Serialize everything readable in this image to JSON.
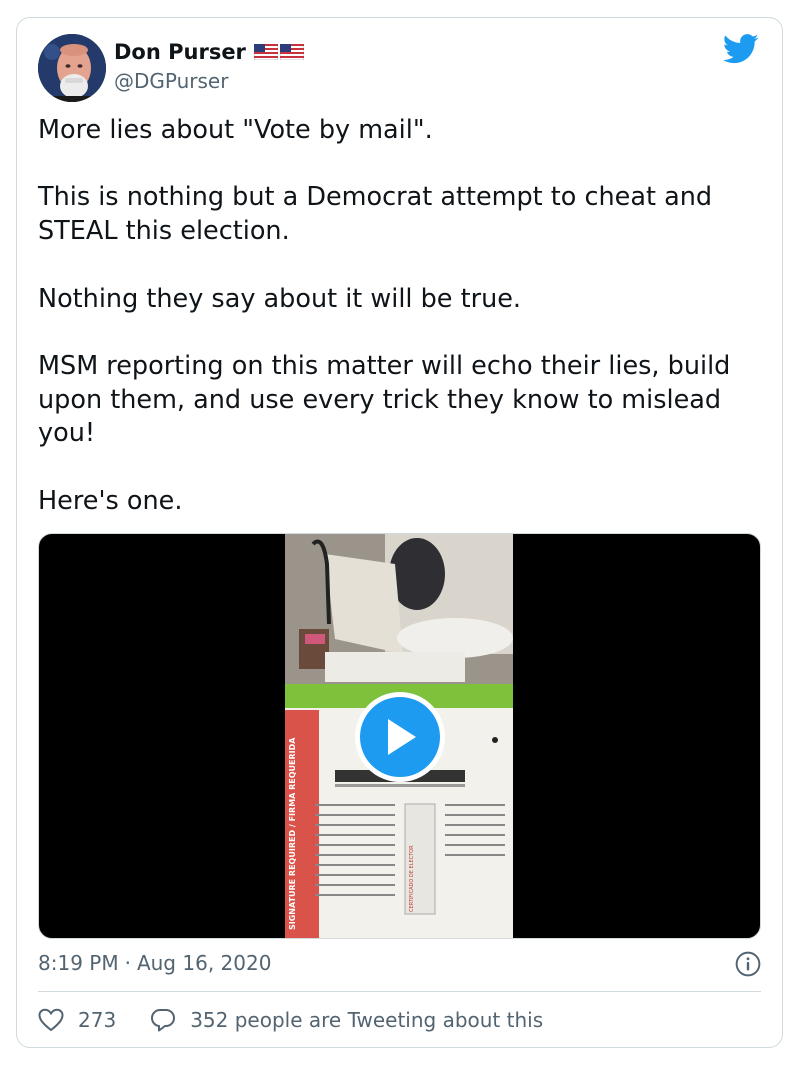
{
  "author": {
    "name": "Don Purser",
    "handle": "@DGPurser",
    "flags": [
      "us-flag",
      "us-flag"
    ]
  },
  "tweet": {
    "text": "More lies about \"Vote by mail\".\n\nThis is nothing but a Democrat attempt to cheat and STEAL this election.\n\nNothing they say about it will be true.\n\nMSM reporting on this matter will echo their lies, build upon them, and use every trick they know to mislead you!\n\nHere's one.",
    "time": "8:19 PM",
    "separator": "·",
    "date": "Aug 16, 2020"
  },
  "media": {
    "type": "video",
    "overlay_icon": "play-icon",
    "thumbnail_texts": {
      "signature_required": "SIGNATURE REQUIRED / FIRMA REQUERIDA",
      "certificate": "CERTIFICADO DE ELECTOR"
    }
  },
  "engagement": {
    "likes": "273",
    "conversation": "352 people are Tweeting about this"
  },
  "colors": {
    "accent": "#1d9bf0",
    "text": "#0f1419",
    "secondary": "#536471",
    "border": "#cfd9de",
    "like_icon": "#536471"
  },
  "icons": {
    "brand": "twitter-bird-icon",
    "info": "info-icon",
    "like": "heart-icon",
    "reply": "speech-bubble-icon"
  }
}
